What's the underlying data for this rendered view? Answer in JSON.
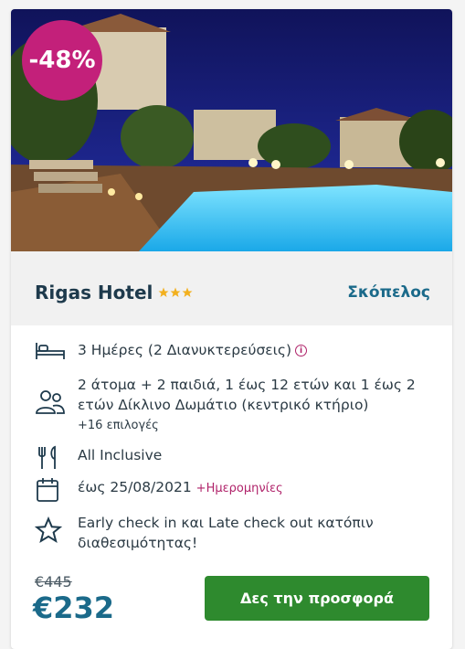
{
  "offer": {
    "discount": "-48%",
    "hotel_name": "Rigas Hotel",
    "stars": 3,
    "location": "Σκόπελος",
    "duration": "3 Ημέρες (2 Διανυκτερεύσεις)",
    "guests_line1": "2 άτομα + 2 παιδιά, 1 έως 12 ετών και 1 έως 2",
    "guests_line2": "ετών Δίκλινο Δωμάτιο (κεντρικό κτήριο)",
    "more_options": "+16 επιλογές",
    "board": "All Inclusive",
    "date_until": "έως 25/08/2021",
    "more_dates": "+Ημερομηνίες",
    "extra_line1": "Early check in και Late check out κατόπιν",
    "extra_line2": "διαθεσιμότητας!",
    "old_price": "€445",
    "price": "€232",
    "cta_label": "Δες την προσφορά",
    "info_glyph": "i"
  },
  "colors": {
    "badge": "#c3207a",
    "accent": "#1b6a8a",
    "link": "#b0236a",
    "cta": "#2e8a2e",
    "star": "#f2b01e"
  },
  "icons": [
    "bed-icon",
    "people-icon",
    "cutlery-icon",
    "calendar-icon",
    "star-outline-icon",
    "info-icon"
  ]
}
